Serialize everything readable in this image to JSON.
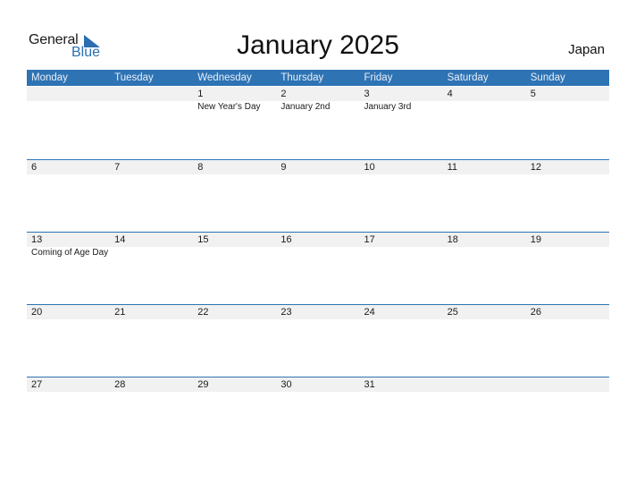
{
  "logo": {
    "text1": "General",
    "text2": "Blue"
  },
  "title": "January 2025",
  "country": "Japan",
  "colors": {
    "accent": "#2e73b4",
    "row_shade": "#f1f1f1"
  },
  "weekdays": [
    "Monday",
    "Tuesday",
    "Wednesday",
    "Thursday",
    "Friday",
    "Saturday",
    "Sunday"
  ],
  "weeks": [
    {
      "days": [
        "",
        "",
        "1",
        "2",
        "3",
        "4",
        "5"
      ],
      "events": [
        "",
        "",
        "New Year's Day",
        "January 2nd",
        "January 3rd",
        "",
        ""
      ]
    },
    {
      "days": [
        "6",
        "7",
        "8",
        "9",
        "10",
        "11",
        "12"
      ],
      "events": [
        "",
        "",
        "",
        "",
        "",
        "",
        ""
      ]
    },
    {
      "days": [
        "13",
        "14",
        "15",
        "16",
        "17",
        "18",
        "19"
      ],
      "events": [
        "Coming of Age Day",
        "",
        "",
        "",
        "",
        "",
        ""
      ]
    },
    {
      "days": [
        "20",
        "21",
        "22",
        "23",
        "24",
        "25",
        "26"
      ],
      "events": [
        "",
        "",
        "",
        "",
        "",
        "",
        ""
      ]
    },
    {
      "days": [
        "27",
        "28",
        "29",
        "30",
        "31",
        "",
        ""
      ],
      "events": [
        "",
        "",
        "",
        "",
        "",
        "",
        ""
      ]
    }
  ]
}
